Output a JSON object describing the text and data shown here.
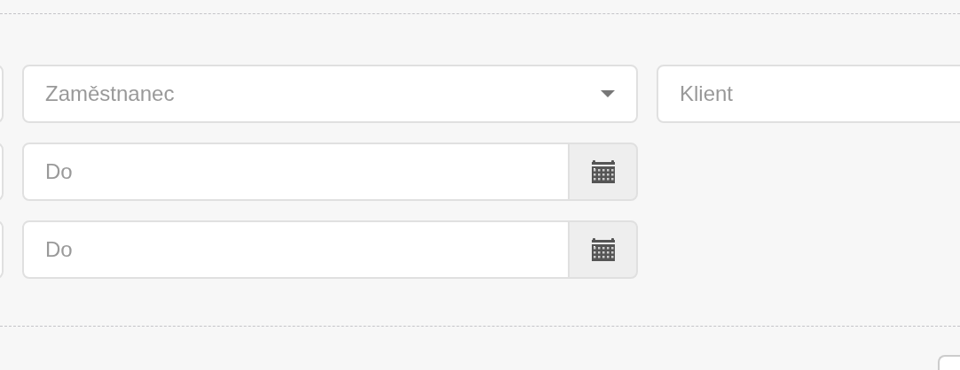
{
  "filters": {
    "employee_select": {
      "placeholder": "Zaměstnanec"
    },
    "client_field": {
      "placeholder": "Klient"
    },
    "date_to_fields": [
      {
        "placeholder": "Do"
      },
      {
        "placeholder": "Do"
      }
    ]
  }
}
